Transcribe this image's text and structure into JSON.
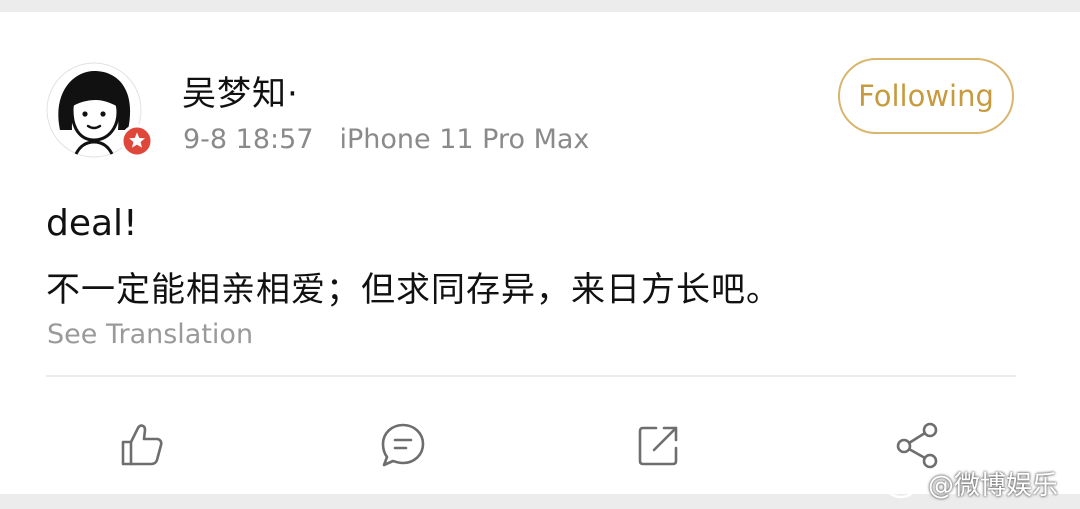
{
  "post": {
    "user_name": "吴梦知",
    "name_separator": "·",
    "time": "9-8 18:57",
    "device": "iPhone 11 Pro Max",
    "follow_label": "Following",
    "text_line1": "deal!",
    "text_line2": "不一定能相亲相爱；但求同存异，来日方长吧。",
    "see_translation": "See Translation"
  },
  "actions": {
    "like_icon": "thumbs-up-icon",
    "comment_icon": "comment-icon",
    "repost_icon": "repost-icon",
    "share_icon": "share-icon"
  },
  "watermark": {
    "text": "@微博娱乐",
    "logo_icon": "weibo-logo-icon"
  },
  "colors": {
    "follow_accent": "#d9b56d",
    "verified_badge": "#e0473b",
    "primary_text": "#111111",
    "secondary_text": "#8a8a8a"
  }
}
